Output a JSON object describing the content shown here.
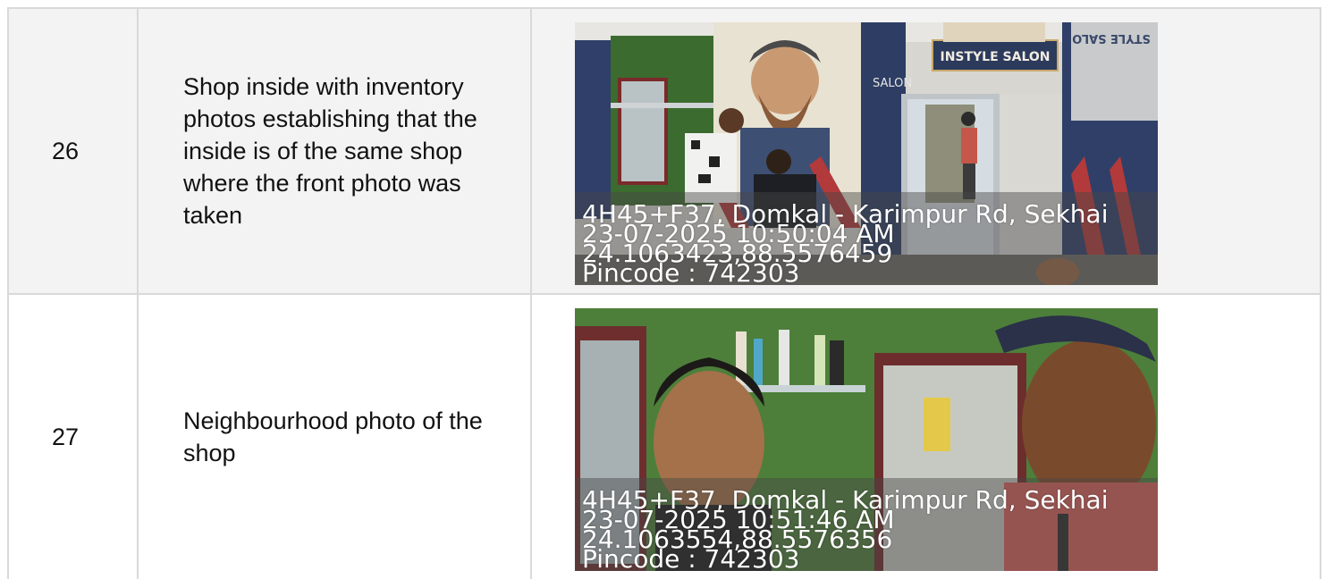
{
  "rows": [
    {
      "number": "26",
      "description": "Shop inside with inventory photos establishing that the inside is of the same shop where the front photo was taken",
      "photo": {
        "sign_text": "INSTYLE SALON",
        "mirror_sign_text": "STYLE SALO",
        "wall_text": "SALON",
        "stamp_lines": [
          "4H45+F37, Domkal - Karimpur Rd, Sekhai",
          "23-07-2025 10:50:04 AM",
          "24.1063423,88.5576459",
          "Pincode : 742303"
        ]
      }
    },
    {
      "number": "27",
      "description": "Neighbourhood photo of the shop",
      "photo": {
        "stamp_lines": [
          "4H45+F37, Domkal - Karimpur Rd, Sekhai",
          "23-07-2025 10:51:46 AM",
          "24.1063554,88.5576356",
          "Pincode : 742303"
        ]
      }
    }
  ],
  "colors": {
    "border": "#d9d9d9",
    "row_shaded": "#f3f3f3",
    "text": "#111111",
    "stamp_text": "#ffffff"
  }
}
